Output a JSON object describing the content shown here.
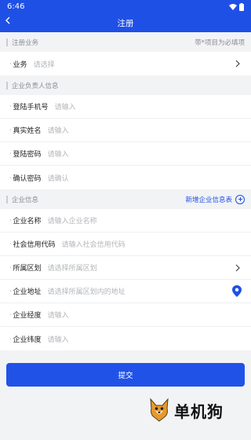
{
  "status": {
    "time": "6:46"
  },
  "nav": {
    "title": "注册"
  },
  "section1": {
    "title": "注册业务",
    "note": "带*项目为必填项"
  },
  "business": {
    "label": "业务",
    "placeholder": "请选择"
  },
  "section2": {
    "title": "企业负责人信息"
  },
  "person": [
    {
      "label": "登陆手机号",
      "placeholder": "请输入"
    },
    {
      "label": "真实姓名",
      "placeholder": "请输入"
    },
    {
      "label": "登陆密码",
      "placeholder": "请输入"
    },
    {
      "label": "确认密码",
      "placeholder": "请确认"
    }
  ],
  "section3": {
    "title": "企业信息",
    "add_label": "新增企业信息表"
  },
  "company": [
    {
      "label": "企业名称",
      "placeholder": "请输入企业名称"
    },
    {
      "label": "社会信用代码",
      "placeholder": "请输入社会信用代码"
    },
    {
      "label": "所属区划",
      "placeholder": "请选择所属区划"
    },
    {
      "label": "企业地址",
      "placeholder": "请选择所属区划内的地址"
    },
    {
      "label": "企业经度",
      "placeholder": "请输入"
    },
    {
      "label": "企业纬度",
      "placeholder": "请输入"
    }
  ],
  "submit": {
    "label": "提交"
  },
  "watermark": {
    "text": "单机狗"
  },
  "colors": {
    "primary": "#1f50e6",
    "background": "#f2f3f5"
  }
}
